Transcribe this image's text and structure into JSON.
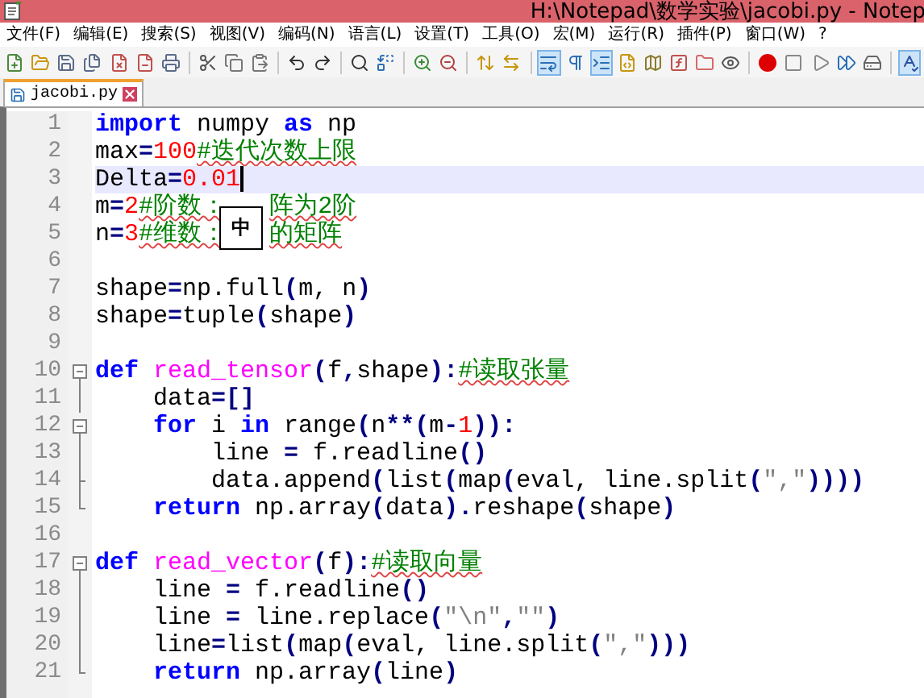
{
  "window": {
    "title": "H:\\Notepad\\数学实验\\jacobi.py - Notep"
  },
  "menu": [
    "文件(F)",
    "编辑(E)",
    "搜索(S)",
    "视图(V)",
    "编码(N)",
    "语言(L)",
    "设置(T)",
    "工具(O)",
    "宏(M)",
    "运行(R)",
    "插件(P)",
    "窗口(W)",
    "?"
  ],
  "toolbar": [
    {
      "kind": "new"
    },
    {
      "kind": "open"
    },
    {
      "kind": "save"
    },
    {
      "kind": "saveall"
    },
    {
      "kind": "close"
    },
    {
      "kind": "closeall"
    },
    {
      "kind": "print"
    },
    {
      "kind": "separator"
    },
    {
      "kind": "cut"
    },
    {
      "kind": "copy"
    },
    {
      "kind": "paste"
    },
    {
      "kind": "separator"
    },
    {
      "kind": "undo"
    },
    {
      "kind": "redo"
    },
    {
      "kind": "separator"
    },
    {
      "kind": "find"
    },
    {
      "kind": "replace"
    },
    {
      "kind": "separator"
    },
    {
      "kind": "zoomin"
    },
    {
      "kind": "zoomout"
    },
    {
      "kind": "separator"
    },
    {
      "kind": "syncv"
    },
    {
      "kind": "synch"
    },
    {
      "kind": "separator"
    },
    {
      "kind": "wrap",
      "pressed": true
    },
    {
      "kind": "allchars"
    },
    {
      "kind": "indent",
      "pressed": true
    },
    {
      "kind": "lang"
    },
    {
      "kind": "docmap"
    },
    {
      "kind": "funclist"
    },
    {
      "kind": "folder"
    },
    {
      "kind": "monitor"
    },
    {
      "kind": "separator"
    },
    {
      "kind": "record"
    },
    {
      "kind": "stop"
    },
    {
      "kind": "play"
    },
    {
      "kind": "playmulti"
    },
    {
      "kind": "savemacro"
    },
    {
      "kind": "separator"
    },
    {
      "kind": "spell",
      "pressed": true
    }
  ],
  "tabs": [
    {
      "label": "jacobi.py",
      "selected": true
    }
  ],
  "editor": {
    "lines": [
      {
        "number": "1",
        "current": false,
        "kind": "plain",
        "tokens": [
          {
            "kind": "kw",
            "text": "import"
          },
          {
            "kind": "plain",
            "text": " numpy "
          },
          {
            "kind": "kw",
            "text": "as"
          },
          {
            "kind": "plain",
            "text": " np"
          }
        ]
      },
      {
        "number": "2",
        "current": false,
        "kind": "plain",
        "tokens": [
          {
            "kind": "plain",
            "text": "max"
          },
          {
            "kind": "op",
            "text": "="
          },
          {
            "kind": "num",
            "text": "100"
          },
          {
            "kind": "comment",
            "text": "#迭代次数上限"
          }
        ]
      },
      {
        "number": "3",
        "current": true,
        "kind": "plain",
        "tokens": [
          {
            "kind": "plain",
            "text": "Delta"
          },
          {
            "kind": "op",
            "text": "="
          },
          {
            "kind": "num",
            "text": "0.01"
          }
        ]
      },
      {
        "number": "4",
        "current": false,
        "kind": "plain",
        "ime": "中",
        "tokens": [
          {
            "kind": "plain",
            "text": "m"
          },
          {
            "kind": "op",
            "text": "="
          },
          {
            "kind": "num",
            "text": "2"
          },
          {
            "kind": "comment",
            "text": "#阶数："
          },
          {
            "kind": "comment",
            "text": "   阵为2阶"
          }
        ]
      },
      {
        "number": "5",
        "current": false,
        "kind": "plain",
        "tokens": [
          {
            "kind": "plain",
            "text": "n"
          },
          {
            "kind": "op",
            "text": "="
          },
          {
            "kind": "num",
            "text": "3"
          },
          {
            "kind": "comment",
            "text": "#维数："
          },
          {
            "kind": "comment",
            "text": "   的矩阵"
          }
        ]
      },
      {
        "number": "6",
        "current": false,
        "kind": "plain"
      },
      {
        "number": "7",
        "current": false,
        "kind": "plain",
        "tokens": [
          {
            "kind": "plain",
            "text": "shape"
          },
          {
            "kind": "op",
            "text": "="
          },
          {
            "kind": "plain",
            "text": "np.full"
          },
          {
            "kind": "op",
            "text": "("
          },
          {
            "kind": "plain",
            "text": "m, n"
          },
          {
            "kind": "op",
            "text": ")"
          }
        ]
      },
      {
        "number": "8",
        "current": false,
        "kind": "plain",
        "tokens": [
          {
            "kind": "plain",
            "text": "shape"
          },
          {
            "kind": "op",
            "text": "="
          },
          {
            "kind": "plain",
            "text": "tuple"
          },
          {
            "kind": "op",
            "text": "("
          },
          {
            "kind": "plain",
            "text": "shape"
          },
          {
            "kind": "op",
            "text": ")"
          }
        ]
      },
      {
        "number": "9",
        "current": false,
        "kind": "plain"
      },
      {
        "number": "10",
        "current": false,
        "kind": "start",
        "tokens": [
          {
            "kind": "kw",
            "text": "def "
          },
          {
            "kind": "func",
            "text": "read_tensor"
          },
          {
            "kind": "op",
            "text": "("
          },
          {
            "kind": "plain",
            "text": "f"
          },
          {
            "kind": "op",
            "text": ","
          },
          {
            "kind": "plain",
            "text": "shape"
          },
          {
            "kind": "op",
            "text": "):"
          },
          {
            "kind": "comment",
            "text": "#读取张量"
          }
        ]
      },
      {
        "number": "11",
        "current": false,
        "kind": "body",
        "tokens": [
          {
            "kind": "plain",
            "text": "    data"
          },
          {
            "kind": "op",
            "text": "=[]"
          }
        ]
      },
      {
        "number": "12",
        "current": false,
        "kind": "start",
        "tokens": [
          {
            "kind": "kw",
            "text": "    for"
          },
          {
            "kind": "plain",
            "text": " i "
          },
          {
            "kind": "kw",
            "text": "in"
          },
          {
            "kind": "plain",
            "text": " range"
          },
          {
            "kind": "op",
            "text": "("
          },
          {
            "kind": "plain",
            "text": "n"
          },
          {
            "kind": "op",
            "text": "**("
          },
          {
            "kind": "plain",
            "text": "m"
          },
          {
            "kind": "op",
            "text": "-"
          },
          {
            "kind": "num",
            "text": "1"
          },
          {
            "kind": "op",
            "text": ")):"
          }
        ]
      },
      {
        "number": "13",
        "current": false,
        "kind": "body",
        "tokens": [
          {
            "kind": "plain",
            "text": "        line "
          },
          {
            "kind": "op",
            "text": "="
          },
          {
            "kind": "plain",
            "text": " f.readline"
          },
          {
            "kind": "op",
            "text": "()"
          }
        ]
      },
      {
        "number": "14",
        "current": false,
        "kind": "tick",
        "tokens": [
          {
            "kind": "plain",
            "text": "        data.append"
          },
          {
            "kind": "op",
            "text": "("
          },
          {
            "kind": "plain",
            "text": "list"
          },
          {
            "kind": "op",
            "text": "("
          },
          {
            "kind": "plain",
            "text": "map"
          },
          {
            "kind": "op",
            "text": "("
          },
          {
            "kind": "plain",
            "text": "eval, line.split"
          },
          {
            "kind": "op",
            "text": "("
          },
          {
            "kind": "str",
            "text": "\",\""
          },
          {
            "kind": "op",
            "text": "))))"
          }
        ]
      },
      {
        "number": "15",
        "current": false,
        "kind": "end",
        "tokens": [
          {
            "kind": "kw",
            "text": "    return"
          },
          {
            "kind": "plain",
            "text": " np.array"
          },
          {
            "kind": "op",
            "text": "("
          },
          {
            "kind": "plain",
            "text": "data"
          },
          {
            "kind": "op",
            "text": ")."
          },
          {
            "kind": "plain",
            "text": "reshape"
          },
          {
            "kind": "op",
            "text": "("
          },
          {
            "kind": "plain",
            "text": "shape"
          },
          {
            "kind": "op",
            "text": ")"
          }
        ]
      },
      {
        "number": "16",
        "current": false,
        "kind": "plain"
      },
      {
        "number": "17",
        "current": false,
        "kind": "start",
        "tokens": [
          {
            "kind": "kw",
            "text": "def "
          },
          {
            "kind": "func",
            "text": "read_vector"
          },
          {
            "kind": "op",
            "text": "("
          },
          {
            "kind": "plain",
            "text": "f"
          },
          {
            "kind": "op",
            "text": "):"
          },
          {
            "kind": "comment",
            "text": "#读取向量"
          }
        ]
      },
      {
        "number": "18",
        "current": false,
        "kind": "body",
        "tokens": [
          {
            "kind": "plain",
            "text": "    line "
          },
          {
            "kind": "op",
            "text": "="
          },
          {
            "kind": "plain",
            "text": " f.readline"
          },
          {
            "kind": "op",
            "text": "()"
          }
        ]
      },
      {
        "number": "19",
        "current": false,
        "kind": "body",
        "tokens": [
          {
            "kind": "plain",
            "text": "    line "
          },
          {
            "kind": "op",
            "text": "="
          },
          {
            "kind": "plain",
            "text": " line.replace"
          },
          {
            "kind": "op",
            "text": "("
          },
          {
            "kind": "str",
            "text": "\"\\n\""
          },
          {
            "kind": "op",
            "text": ","
          },
          {
            "kind": "str",
            "text": "\"\""
          },
          {
            "kind": "op",
            "text": ")"
          }
        ]
      },
      {
        "number": "20",
        "current": false,
        "kind": "body",
        "tokens": [
          {
            "kind": "plain",
            "text": "    line"
          },
          {
            "kind": "op",
            "text": "="
          },
          {
            "kind": "plain",
            "text": "list"
          },
          {
            "kind": "op",
            "text": "("
          },
          {
            "kind": "plain",
            "text": "map"
          },
          {
            "kind": "op",
            "text": "("
          },
          {
            "kind": "plain",
            "text": "eval, line.split"
          },
          {
            "kind": "op",
            "text": "("
          },
          {
            "kind": "str",
            "text": "\",\""
          },
          {
            "kind": "op",
            "text": ")))"
          }
        ]
      },
      {
        "number": "21",
        "current": false,
        "kind": "end",
        "tokens": [
          {
            "kind": "kw",
            "text": "    return"
          },
          {
            "kind": "plain",
            "text": " np.array"
          },
          {
            "kind": "op",
            "text": "("
          },
          {
            "kind": "plain",
            "text": "line"
          },
          {
            "kind": "op",
            "text": ")"
          }
        ]
      }
    ]
  }
}
